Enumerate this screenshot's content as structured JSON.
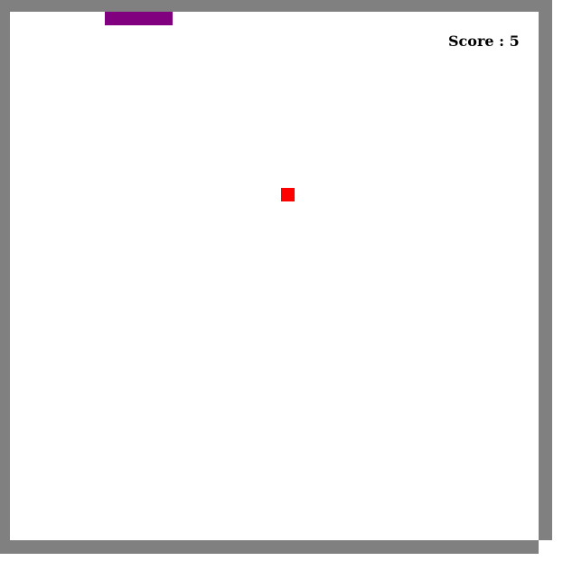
{
  "score": {
    "label": "Score",
    "separator": " : ",
    "value": "5"
  },
  "colors": {
    "wall": "#808080",
    "background": "#ffffff",
    "snake": "#800080",
    "food": "#ff0000",
    "text": "#000000"
  },
  "entities": {
    "snake_length_segments": 5
  }
}
